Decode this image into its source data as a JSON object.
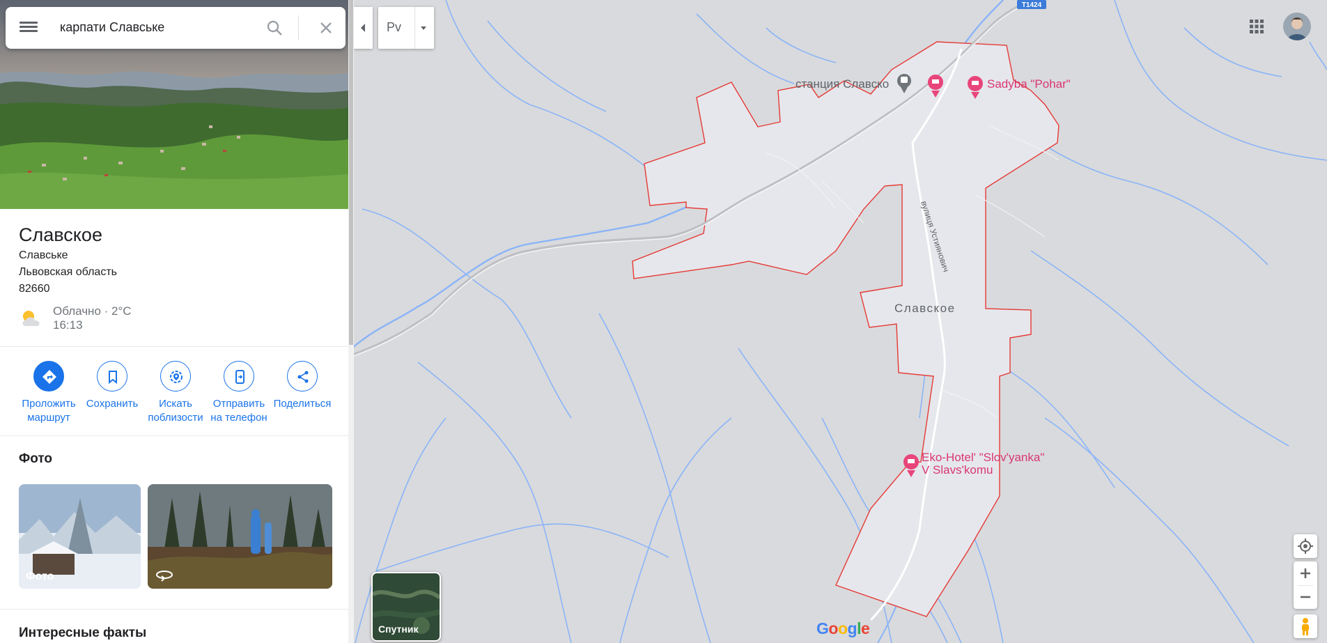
{
  "search": {
    "query": "карпати Славське"
  },
  "place": {
    "title": "Славское",
    "address_lines": [
      "Славське",
      "Львовская область",
      "82660"
    ],
    "weather": "Облачно · 2°C",
    "time": "16:13"
  },
  "actions": [
    {
      "line1": "Проложить",
      "line2": "маршрут"
    },
    {
      "line1": "Сохранить",
      "line2": ""
    },
    {
      "line1": "Искать",
      "line2": "поблизости"
    },
    {
      "line1": "Отправить",
      "line2": "на телефон"
    },
    {
      "line1": "Поделиться",
      "line2": ""
    }
  ],
  "photos": {
    "title": "Фото",
    "first_caption": "Фото"
  },
  "facts": {
    "title": "Интересные факты"
  },
  "map": {
    "lang_button": "Pv",
    "satellite_label": "Спутник",
    "road_shield": "T1424",
    "town_label": "Славское",
    "street_label": "вулиця Устиянович",
    "station_label": "станция Славско",
    "hotel1": "Sadyba \"Pohar\"",
    "hotel2_line1": "Eko-Hotel' \"Slov'yanka\"",
    "hotel2_line2": "V Slavs'komu",
    "logo": "Google",
    "colors": {
      "boundary": "#e53935",
      "water": "#8ab4f8",
      "hotel_pin": "#e8457a",
      "accent": "#1a73e8"
    }
  }
}
